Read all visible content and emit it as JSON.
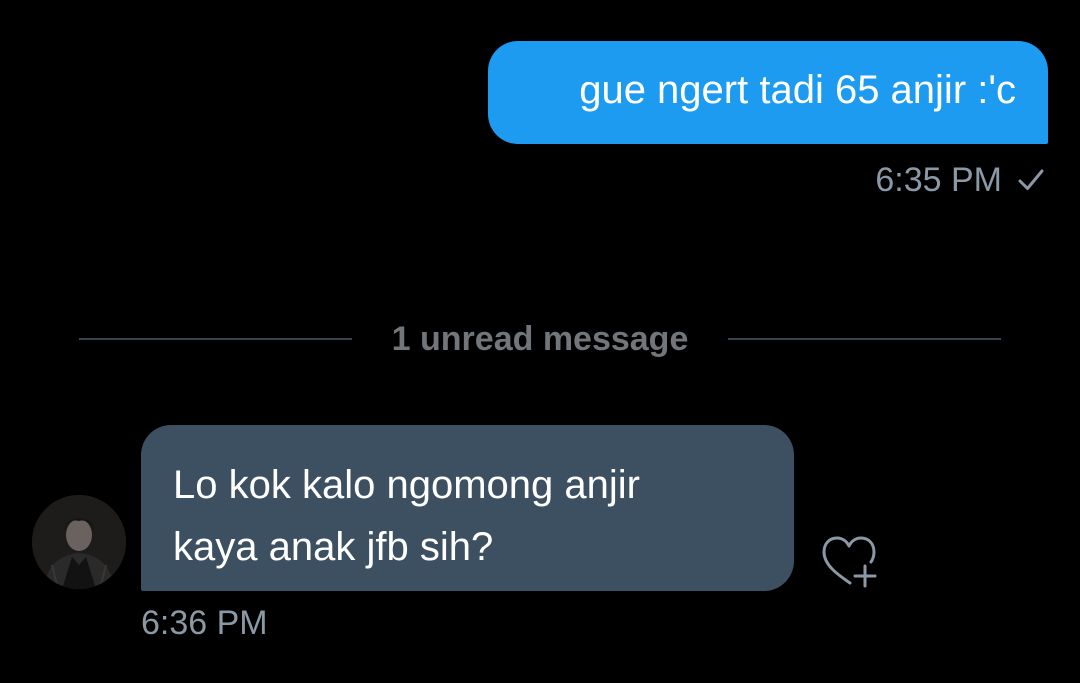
{
  "conversation": {
    "outgoing": {
      "text": "gue ngert tadi 65 anjir :'c",
      "time": "6:35 PM",
      "status_icon": "check-icon"
    },
    "unread_divider": {
      "label": "1 unread message"
    },
    "incoming": {
      "lines": [
        "Lo kok kalo ngomong anjir",
        "kaya anak jfb sih?"
      ],
      "time": "6:36 PM",
      "react_icon": "heart-plus-icon",
      "avatar_icon": "avatar"
    }
  },
  "colors": {
    "background": "#000000",
    "outgoing_bubble": "#1d9bf0",
    "incoming_bubble": "#3c5061",
    "meta_text": "#8b98a5",
    "divider_line": "#38444d"
  }
}
